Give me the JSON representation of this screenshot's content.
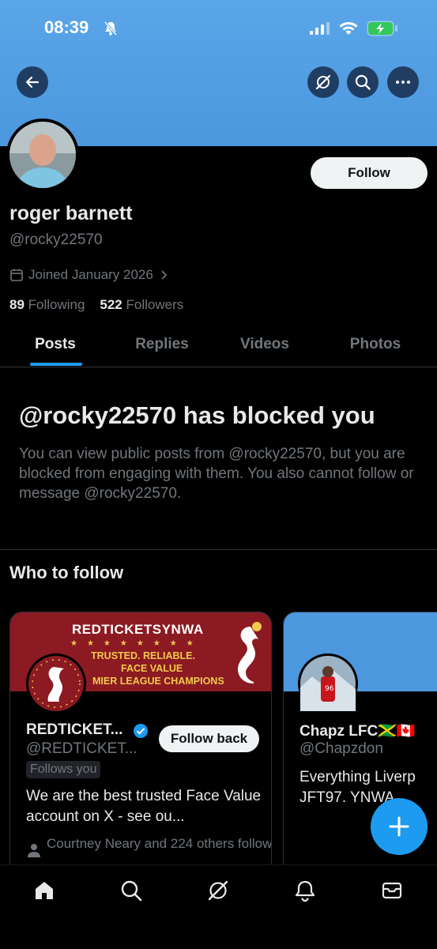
{
  "status_bar": {
    "time": "08:39"
  },
  "header": {
    "back_icon": "arrow-left-icon",
    "grok_icon": "grok-icon",
    "search_icon": "search-icon",
    "more_icon": "more-icon"
  },
  "profile": {
    "name": "roger barnett",
    "handle": "@rocky22570",
    "joined": "Joined January 2026",
    "following_count": "89",
    "following_label": "Following",
    "followers_count": "522",
    "followers_label": "Followers",
    "follow_label": "Follow"
  },
  "tabs": [
    {
      "label": "Posts",
      "active": true
    },
    {
      "label": "Replies",
      "active": false
    },
    {
      "label": "Videos",
      "active": false
    },
    {
      "label": "Photos",
      "active": false
    }
  ],
  "blocked": {
    "title": "@rocky22570 has blocked you",
    "text": "You can view public posts from @rocky22570, but you are blocked from engaging with them. You also cannot follow or message @rocky22570."
  },
  "who_to_follow": {
    "title": "Who to follow",
    "cards": [
      {
        "name": "REDTICKET...",
        "handle": "@REDTICKET...",
        "follows_you": "Follows you",
        "button": "Follow back",
        "bio": "We are the best trusted Face Value account on X - see ou...",
        "social": "Courtney Neary and 224 others follow",
        "banner_title": "REDTICKETSYNWA",
        "banner_line1": "TRUSTED. RELIABLE.",
        "banner_line2": "FACE VALUE",
        "banner_line3": "MIER LEAGUE CHAMPIONS",
        "accent": "#8b1a22"
      },
      {
        "name": "Chapz LFC🇯🇲🇨🇦",
        "handle": "@Chapzdon",
        "bio_line1": "Everything Liverp",
        "bio_line2": "JFT97. YNWA"
      }
    ]
  },
  "colors": {
    "accent": "#1d9bf0",
    "banner": "#4c97de"
  },
  "nav": [
    "home-icon",
    "search-icon",
    "grok-icon",
    "notifications-icon",
    "messages-icon"
  ]
}
